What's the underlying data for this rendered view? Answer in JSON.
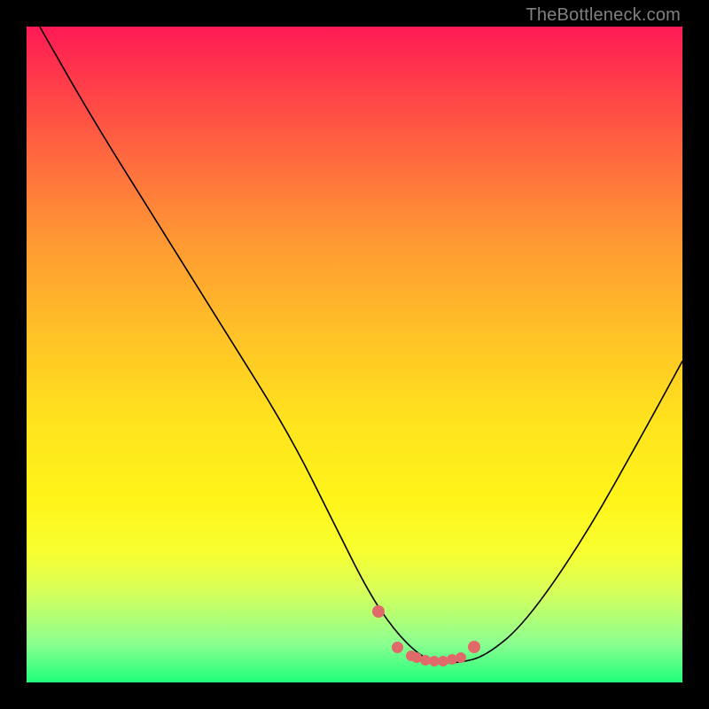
{
  "watermark": {
    "text": "TheBottleneck.com"
  },
  "chart_data": {
    "type": "line",
    "title": "",
    "xlabel": "",
    "ylabel": "",
    "xlim": [
      0,
      100
    ],
    "ylim": [
      0,
      100
    ],
    "grid": false,
    "legend": null,
    "series": [
      {
        "name": "curve",
        "x": [
          2,
          10,
          20,
          30,
          40,
          47,
          52,
          56,
          60,
          63,
          66,
          70,
          76,
          85,
          94,
          100
        ],
        "y": [
          100,
          86,
          70,
          54,
          38,
          24,
          14,
          8,
          4,
          3,
          3,
          4,
          9,
          22,
          38,
          49
        ]
      }
    ],
    "highlight_points": {
      "name": "near-zero-band",
      "x": [
        53.6,
        56.6,
        58.6,
        59.4,
        60.8,
        62.1,
        63.5,
        64.8,
        66.2,
        68.2
      ],
      "y": [
        10.8,
        5.4,
        4.0,
        3.8,
        3.4,
        3.2,
        3.2,
        3.5,
        3.8,
        5.4
      ]
    },
    "background_gradient": {
      "orientation": "vertical",
      "stops": [
        {
          "pos": 0.0,
          "color": "#ff1a55"
        },
        {
          "pos": 0.2,
          "color": "#ff6a3f"
        },
        {
          "pos": 0.47,
          "color": "#ffc227"
        },
        {
          "pos": 0.72,
          "color": "#fff41a"
        },
        {
          "pos": 0.94,
          "color": "#8cff90"
        },
        {
          "pos": 1.0,
          "color": "#1fff7a"
        }
      ]
    }
  }
}
